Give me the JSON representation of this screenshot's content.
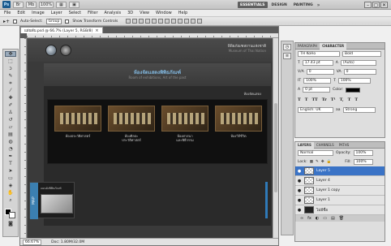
{
  "appbar": {
    "logo": "Ps",
    "buttons": [
      "Br",
      "Mb",
      "▾",
      "100%",
      "▾",
      "▦",
      "▾",
      "▣",
      "▾"
    ],
    "workspaces": [
      {
        "label": "ESSENTIALS",
        "active": true
      },
      {
        "label": "DESIGN",
        "active": false
      },
      {
        "label": "PAINTING",
        "active": false
      }
    ],
    "more": "»",
    "window_buttons": [
      "–",
      "▢",
      "✕"
    ]
  },
  "menu": [
    "File",
    "Edit",
    "Image",
    "Layer",
    "Select",
    "Filter",
    "Analysis",
    "3D",
    "View",
    "Window",
    "Help"
  ],
  "options": {
    "tool_icon": "move-tool-icon",
    "auto_select_label": "Auto-Select:",
    "auto_select_value": "Group",
    "show_transform_label": "Show Transform Controls"
  },
  "document": {
    "tab_label": "แผ่นพับ.psd @ 66.7% (Layer 5, RGB/8)",
    "tab_close": "×",
    "zoom": "66.67%",
    "doc_size": "Doc: 1.80M/32.0M"
  },
  "canvas": {
    "header_title": "พิพิธภัณฑสถานแห่งชาติ",
    "header_sub": "Museum of Thai Nation",
    "banner_title": "ห้องจัดแสดงพิพิธภัณฑ์",
    "banner_sub": "Room of exhibitions, Art of the past",
    "banner_tag": "ห้องจัดแสดง",
    "cards": [
      {
        "caption": "ห้องประวัติศาสตร์"
      },
      {
        "caption": "ห้องศิลปะ\nประวัติศาสตร์"
      },
      {
        "caption": "ห้องศาสนา\nและพิธีกรรม"
      },
      {
        "caption": "ห้องวิถีชีวิต"
      }
    ],
    "map_tab": "MAP",
    "map_caption": "แผนผังพิพิธภัณฑ์"
  },
  "character_panel": {
    "tabs": [
      "PARAGRAPH",
      "CHARACTER"
    ],
    "active_tab": "CHARACTER",
    "font_family": "TH KoHo",
    "font_style": "Bold",
    "size": "17.43 pt",
    "leading": "(Auto)",
    "kerning": "0",
    "tracking": "0",
    "vscale": "100%",
    "hscale": "100%",
    "baseline": "0 pt",
    "color_label": "Color:",
    "styles": [
      "T",
      "T",
      "TT",
      "Tr",
      "T¹",
      "T,",
      "T",
      "T"
    ],
    "language": "English: UK",
    "antialias": "Strong"
  },
  "layers_panel": {
    "tabs": [
      "LAYERS",
      "CHANNELS",
      "PATHS"
    ],
    "active_tab": "LAYERS",
    "blend_mode": "Normal",
    "opacity_label": "Opacity:",
    "opacity": "100%",
    "lock_label": "Lock:",
    "fill_label": "Fill:",
    "fill": "100%",
    "layers": [
      {
        "name": "Layer 5",
        "selected": true
      },
      {
        "name": "Layer 4",
        "selected": false
      },
      {
        "name": "Layer 1 copy",
        "selected": false
      },
      {
        "name": "Layer 1",
        "selected": false
      },
      {
        "name": "ไม่มีชื่อ",
        "selected": false
      }
    ],
    "footer_icons": [
      "∞",
      "fx",
      "◐",
      "▭",
      "▤",
      "🗑"
    ]
  }
}
